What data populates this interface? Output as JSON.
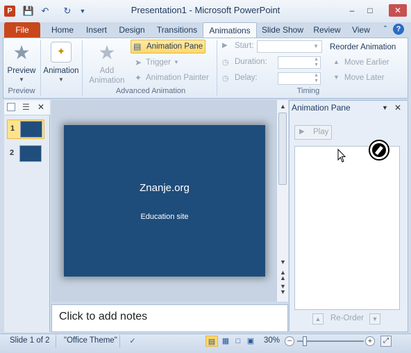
{
  "window": {
    "title": "Presentation1  -  Microsoft PowerPoint",
    "app_icon_letter": "P"
  },
  "quick_access": {
    "icons": [
      "save-icon",
      "undo-icon",
      "redo-icon",
      "customize-dropdown-icon"
    ]
  },
  "tabs": [
    {
      "label": "File"
    },
    {
      "label": "Home"
    },
    {
      "label": "Insert"
    },
    {
      "label": "Design"
    },
    {
      "label": "Transitions"
    },
    {
      "label": "Animations"
    },
    {
      "label": "Slide Show"
    },
    {
      "label": "Review"
    },
    {
      "label": "View"
    }
  ],
  "active_tab": "Animations",
  "ribbon": {
    "preview": {
      "label": "Preview",
      "group_label": "Preview"
    },
    "animation": {
      "label": "Animation"
    },
    "add_animation": {
      "label_line1": "Add",
      "label_line2": "Animation"
    },
    "animation_pane": {
      "label": "Animation Pane"
    },
    "trigger": {
      "label": "Trigger"
    },
    "animation_painter": {
      "label": "Animation Painter"
    },
    "advanced_group_label": "Advanced Animation",
    "timing": {
      "start_label": "Start:",
      "duration_label": "Duration:",
      "delay_label": "Delay:",
      "reorder_label": "Reorder Animation",
      "move_earlier": "Move Earlier",
      "move_later": "Move Later",
      "group_label": "Timing"
    }
  },
  "thumbnails": [
    {
      "number": "1",
      "selected": true
    },
    {
      "number": "2",
      "selected": false
    }
  ],
  "slide": {
    "title": "Znanje.org",
    "subtitle": "Education site"
  },
  "notes": {
    "placeholder": "Click to add notes"
  },
  "animation_pane": {
    "title": "Animation Pane",
    "play_label": "Play",
    "reorder_label": "Re-Order"
  },
  "status": {
    "slide_info": "Slide 1 of 2",
    "theme": "\"Office Theme\"",
    "zoom": "30%"
  },
  "colors": {
    "slide_bg": "#1e4d7b",
    "file_tab": "#c9471d",
    "highlight": "#ffd86a"
  }
}
